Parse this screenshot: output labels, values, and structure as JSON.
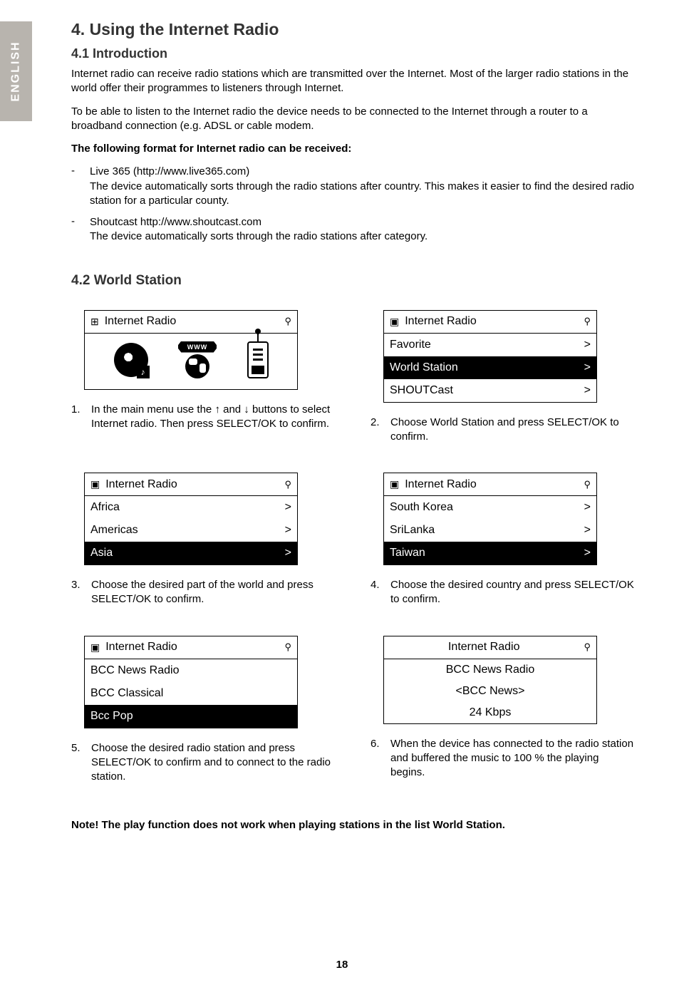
{
  "language_tab": "ENGLISH",
  "h1": "4. Using the Internet Radio",
  "s41": {
    "heading": "4.1 Introduction",
    "p1": "Internet radio can receive radio stations which are transmitted over the Internet. Most of the larger radio stations in the world offer their programmes to listeners through Internet.",
    "p2": "To be able to listen to the Internet radio the device needs to be connected to the Internet through a router to a broadband connection (e.g. ADSL or cable modem.",
    "bold_intro": "The following format for Internet radio can be received:",
    "bullets": [
      {
        "line1": "Live 365 (http://www.live365.com)",
        "line2": "The device automatically sorts through the radio stations after country. This makes it easier to find the desired radio station for a particular county."
      },
      {
        "line1": "Shoutcast http://www.shoutcast.com",
        "line2": "The device automatically sorts through the radio stations after category."
      }
    ]
  },
  "s42": {
    "heading": "4.2 World Station",
    "lcd_title": "Internet Radio",
    "globe_banner": "WWW",
    "screen2": {
      "items": [
        "Favorite",
        "World Station",
        "SHOUTCast"
      ],
      "selected": 1
    },
    "screen3": {
      "items": [
        "Africa",
        "Americas",
        "Asia"
      ],
      "selected": 2
    },
    "screen4": {
      "items": [
        "South Korea",
        "SriLanka",
        "Taiwan"
      ],
      "selected": 2
    },
    "screen5": {
      "items": [
        "BCC News Radio",
        "BCC Classical",
        "Bcc Pop"
      ],
      "selected": 2
    },
    "screen6": {
      "line1": "BCC News Radio",
      "line2": "<BCC News>",
      "line3": "24 Kbps"
    },
    "steps": {
      "1": "In the main menu use the ↑ and ↓ buttons to select Internet radio. Then press SELECT/OK to confirm.",
      "2": "Choose World Station and press SELECT/OK to confirm.",
      "3": "Choose the desired part of the world and press SELECT/OK to confirm.",
      "4": "Choose the desired country and press SELECT/OK to confirm.",
      "5": "Choose the desired radio station and press SELECT/OK to confirm and to connect to the radio station.",
      "6": "When the device has connected to the radio station and buffered the music to 100 % the playing begins."
    },
    "note": "Note! The play function does not work when playing stations in the list World Station."
  },
  "page_number": "18",
  "glyphs": {
    "plus_box": "⊞",
    "play_box": "▣",
    "wifi": "⚲",
    "chev": ">"
  }
}
